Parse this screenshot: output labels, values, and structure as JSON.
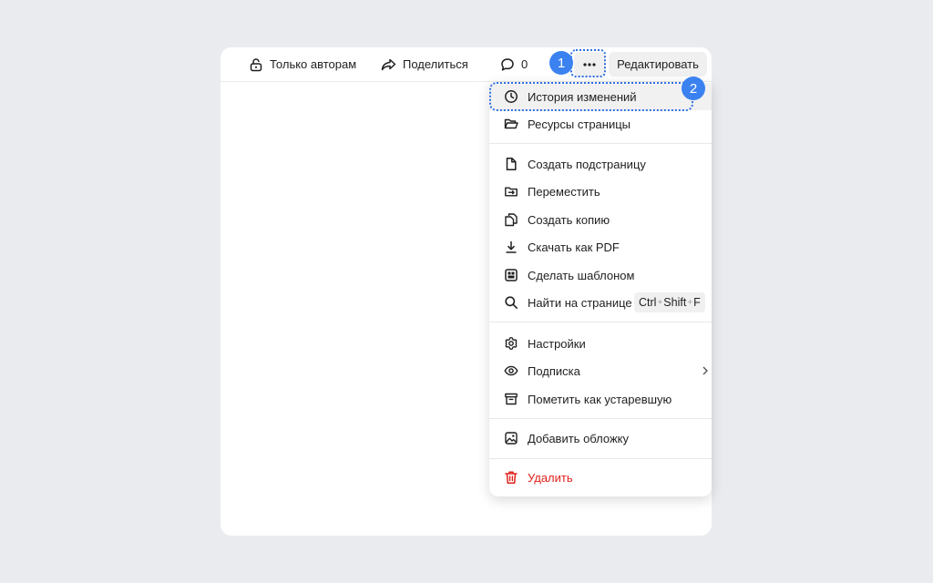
{
  "toolbar": {
    "authors_only_label": "Только авторам",
    "share_label": "Поделиться",
    "comments_count": "0",
    "edit_label": "Редактировать",
    "more_icon": "more-horizontal-icon"
  },
  "annotations": {
    "step1": "1",
    "step2": "2",
    "highlight_color": "#3b82f0"
  },
  "menu": {
    "history": "История изменений",
    "resources": "Ресурсы страницы",
    "create_subpage": "Создать подстраницу",
    "move": "Переместить",
    "create_copy": "Создать копию",
    "download_pdf": "Скачать как PDF",
    "make_template": "Сделать шаблоном",
    "find_on_page": "Найти на странице",
    "shortcut_ctrl": "Ctrl",
    "shortcut_plus": "+",
    "shortcut_shift": "Shift",
    "shortcut_f": "F",
    "settings": "Настройки",
    "subscription": "Подписка",
    "mark_outdated": "Пометить как устаревшую",
    "add_cover": "Добавить обложку",
    "delete": "Удалить",
    "danger_color": "#e0221c"
  }
}
